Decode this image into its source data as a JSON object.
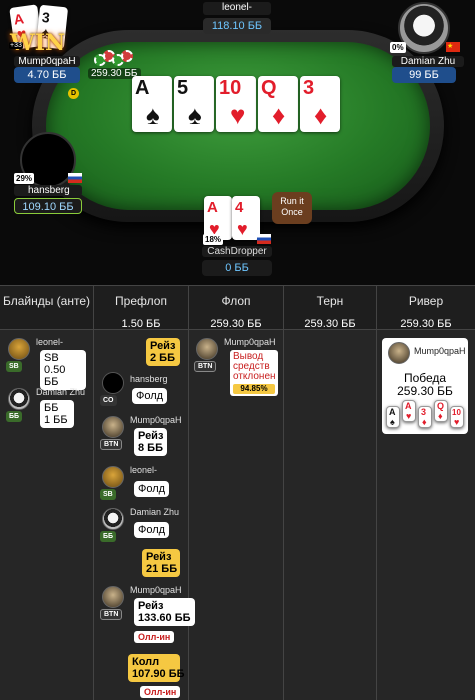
{
  "table": {
    "players": {
      "top_left": {
        "name": "Mump0qpaH",
        "stack": "4.70 ББ",
        "win_text": "WIN",
        "win_badge": "+33"
      },
      "top_center": {
        "name": "leonel-",
        "stack": "118.10 ББ"
      },
      "top_right": {
        "name": "Damian Zhu",
        "stack": "99 ББ",
        "pct": "0%"
      },
      "left": {
        "name": "hansberg",
        "stack": "109.10 ББ",
        "pct": "29%"
      },
      "bottom": {
        "name": "CashDropper",
        "stack": "0 ББ",
        "pct": "18%"
      }
    },
    "pot": "259.30 ББ",
    "dealer_label": "D",
    "run_it_once": "Run it Once",
    "board": [
      {
        "rank": "A",
        "suit": "♠",
        "color": "black"
      },
      {
        "rank": "5",
        "suit": "♠",
        "color": "black"
      },
      {
        "rank": "10",
        "suit": "♥",
        "color": "red"
      },
      {
        "rank": "Q",
        "suit": "♦",
        "color": "red"
      },
      {
        "rank": "3",
        "suit": "♦",
        "color": "red"
      }
    ],
    "winner_cards": [
      {
        "rank": "A",
        "suit": "♥",
        "color": "red"
      },
      {
        "rank": "3",
        "suit": "♠",
        "color": "black"
      }
    ],
    "hero_cards": [
      {
        "rank": "A",
        "suit": "♥",
        "color": "red"
      },
      {
        "rank": "4",
        "suit": "♥",
        "color": "red"
      }
    ]
  },
  "history": {
    "columns": [
      {
        "title": "Блайнды (анте)",
        "amount": ""
      },
      {
        "title": "Префлоп",
        "amount": "1.50 ББ"
      },
      {
        "title": "Флоп",
        "amount": "259.30 ББ"
      },
      {
        "title": "Терн",
        "amount": "259.30 ББ"
      },
      {
        "title": "Ривер",
        "amount": "259.30 ББ"
      }
    ],
    "blinds": [
      {
        "name": "leonel-",
        "pos": "SB",
        "action": "SB",
        "amount": "0.50 ББ"
      },
      {
        "name": "Damian Zhu",
        "pos": "ББ",
        "action": "ББ",
        "amount": "1 ББ"
      }
    ],
    "preflop": {
      "raise1": "Рейз\n2 ББ",
      "hansberg": {
        "name": "hansberg",
        "pos": "CO",
        "action": "Фолд"
      },
      "mump_raise": {
        "name": "Mump0qpaH",
        "pos": "BTN",
        "action": "Рейз",
        "amount": "8 ББ"
      },
      "leonel": {
        "name": "leonel-",
        "pos": "SB",
        "action": "Фолд"
      },
      "damian": {
        "name": "Damian Zhu",
        "pos": "ББ",
        "action": "Фолд"
      },
      "raise2": "Рейз\n21 ББ",
      "mump_allin": {
        "name": "Mump0qpaH",
        "pos": "BTN",
        "action": "Рейз",
        "amount": "133.60 ББ",
        "tag": "Олл-ин"
      },
      "call": "Колл\n107.90 ББ",
      "call_tag": "Олл-ин"
    },
    "flop": {
      "name": "Mump0qpaH",
      "pos": "BTN",
      "warning": "Вывод средств отклонен",
      "equity": "94.85%"
    },
    "river": {
      "name": "Mump0qpaH",
      "result": "Победа",
      "amount": "259.30 ББ",
      "cards": [
        {
          "rank": "A",
          "suit": "♠",
          "color": "black"
        },
        {
          "rank": "A",
          "suit": "♥",
          "color": "red"
        },
        {
          "rank": "3",
          "suit": "♦",
          "color": "red"
        },
        {
          "rank": "Q",
          "suit": "♦",
          "color": "red"
        },
        {
          "rank": "10",
          "suit": "♥",
          "color": "red"
        }
      ]
    }
  }
}
